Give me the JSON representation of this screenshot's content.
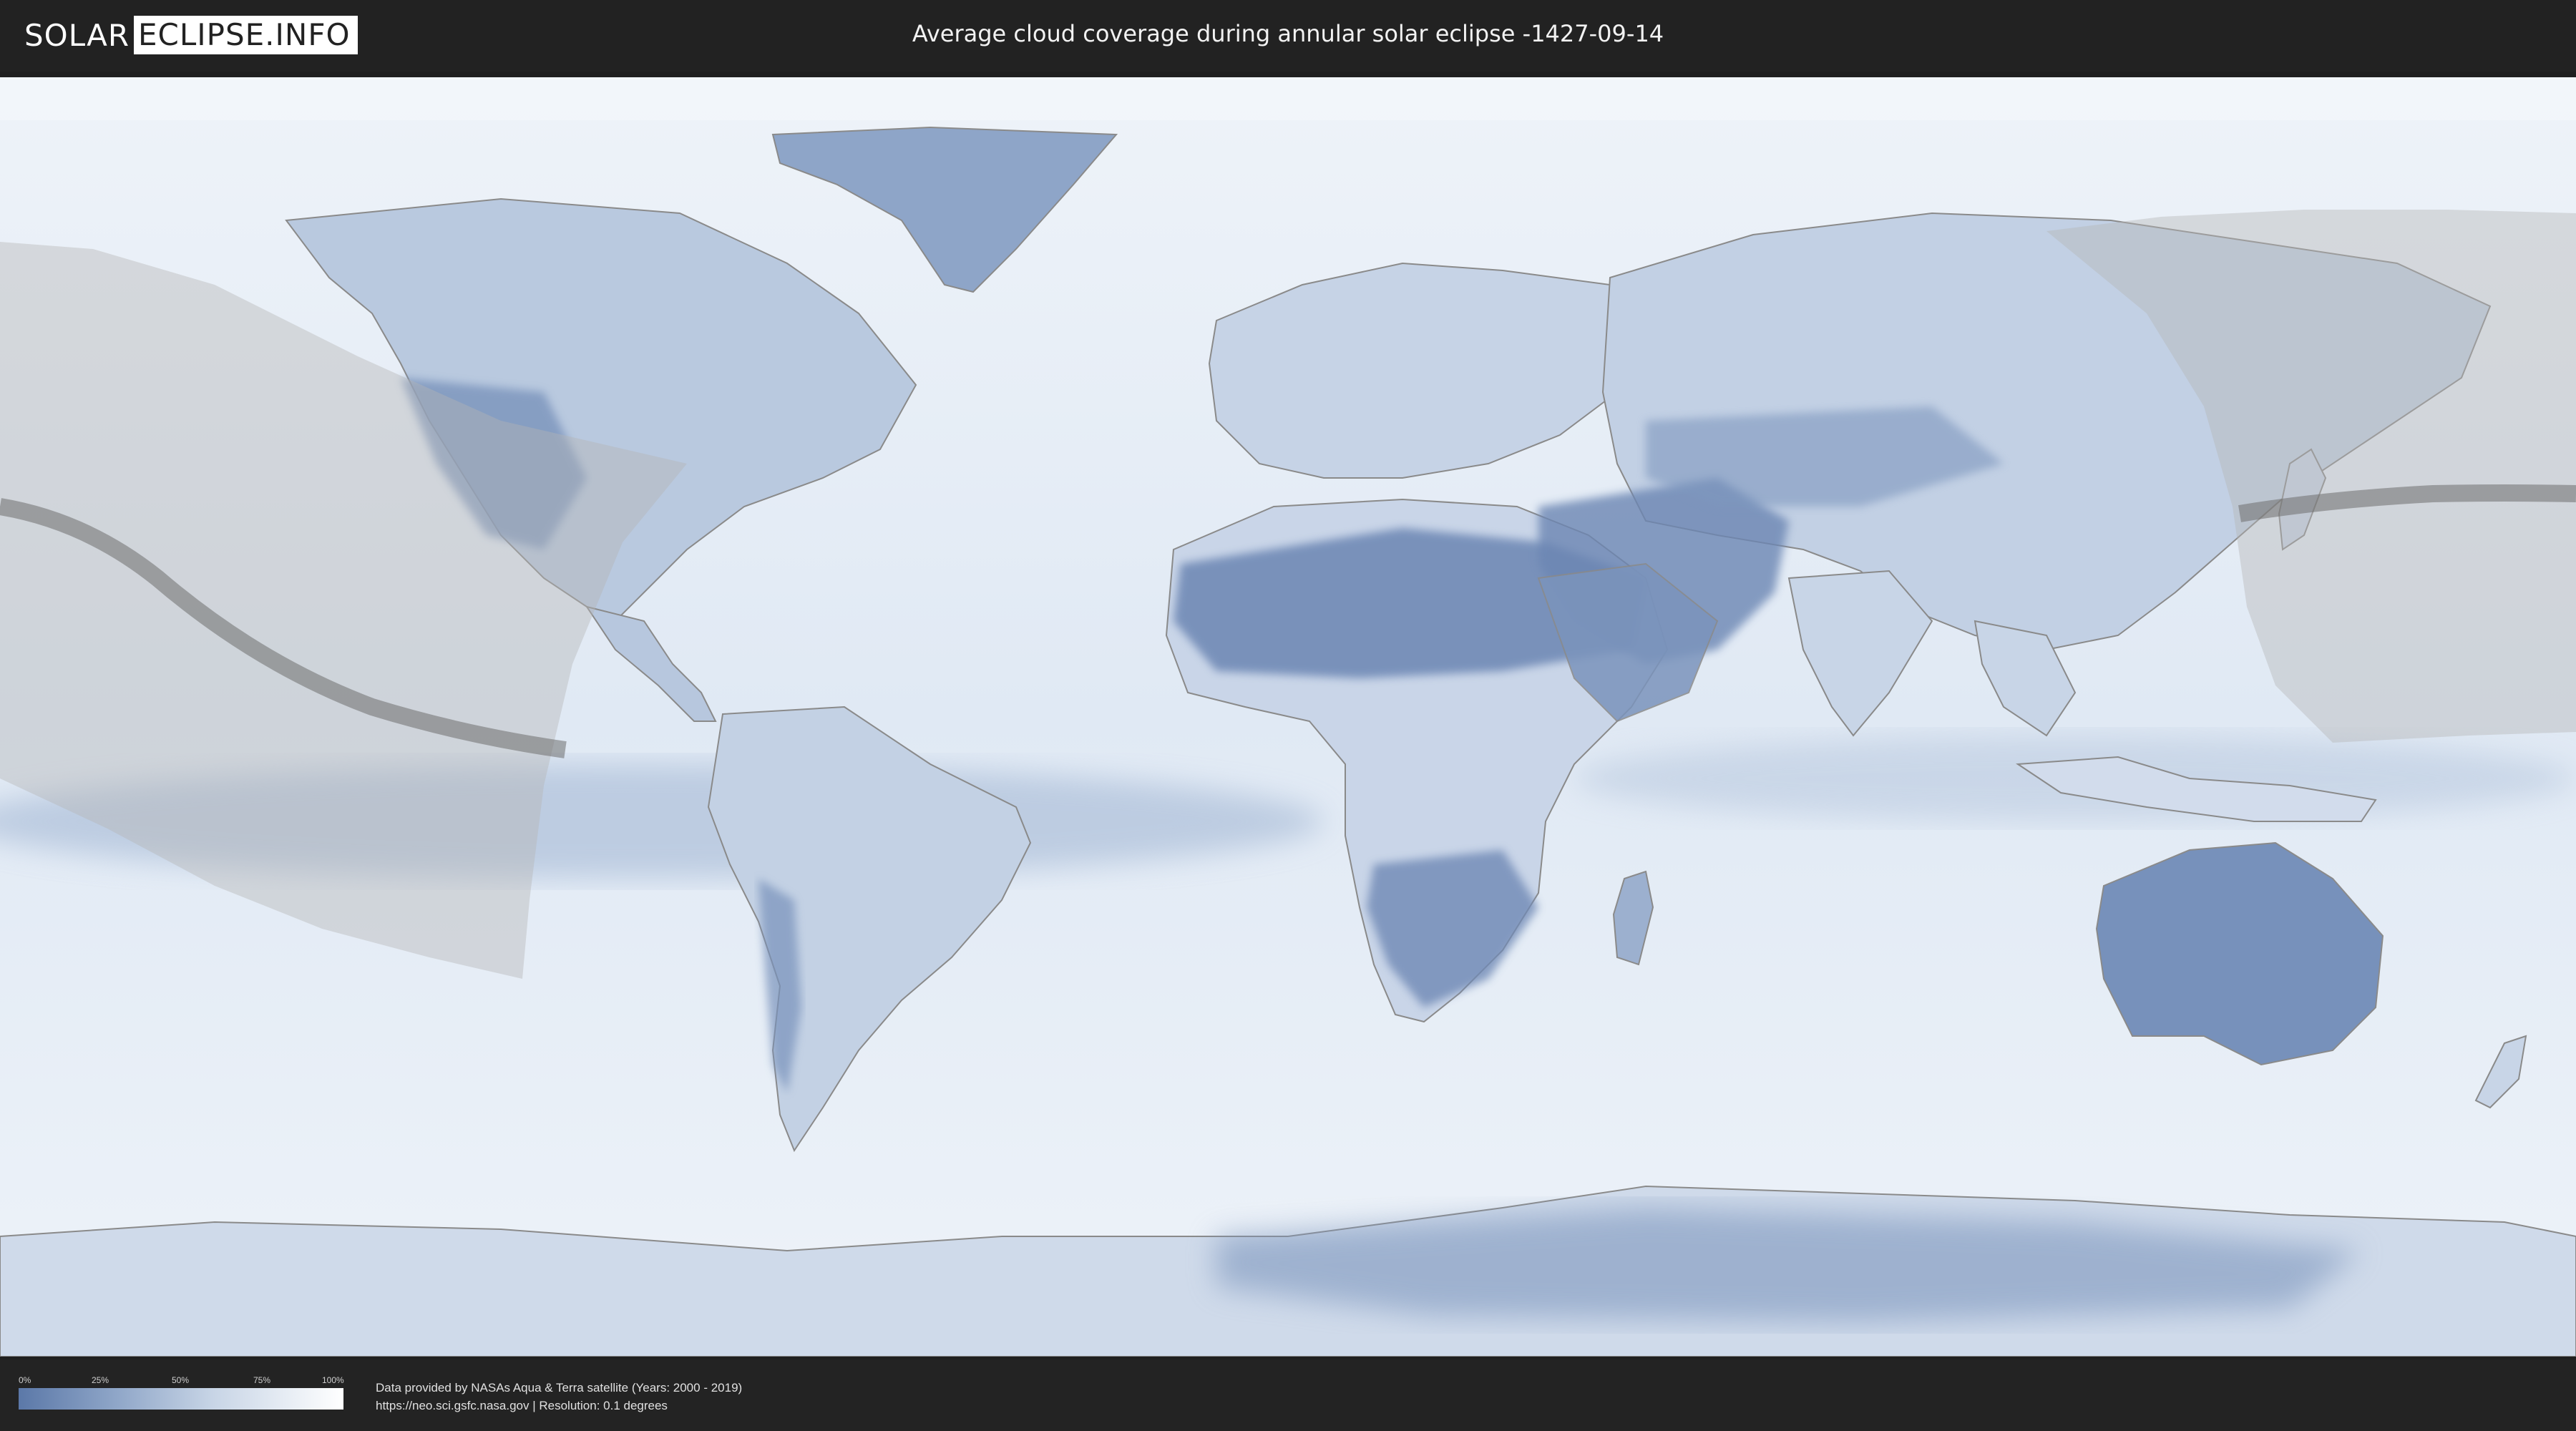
{
  "header": {
    "logo_part1": "SOLAR",
    "logo_part2": "ECLIPSE.INFO",
    "title": "Average cloud coverage during annular solar eclipse -1427-09-14"
  },
  "legend": {
    "ticks": [
      "0%",
      "25%",
      "50%",
      "75%",
      "100%"
    ],
    "colors": {
      "low": "#5b78a8",
      "high": "#ffffff"
    }
  },
  "footer": {
    "credit_line1": "Data provided by NASAs Aqua & Terra satellite (Years: 2000 - 2019)",
    "credit_line2": "https://neo.sci.gsfc.nasa.gov | Resolution: 0.1 degrees"
  },
  "map": {
    "projection": "equirectangular",
    "colors": {
      "ocean_cloud": "#e4ecf6",
      "clear_land": "#6d87b4",
      "eclipse_shade": "#b4b4b4",
      "eclipse_path": "#6e6e6e"
    }
  }
}
